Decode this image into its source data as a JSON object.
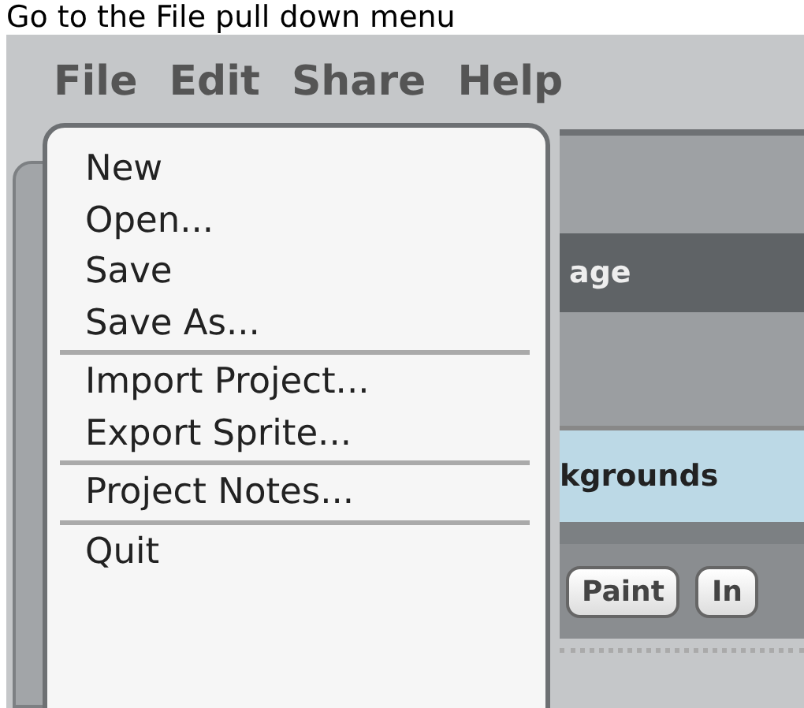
{
  "caption": "Go to the File pull down menu",
  "menubar": [
    "File",
    "Edit",
    "Share",
    "Help"
  ],
  "file_menu": [
    {
      "kind": "item",
      "label": "New"
    },
    {
      "kind": "item",
      "label": "Open..."
    },
    {
      "kind": "item",
      "label": "Save"
    },
    {
      "kind": "item",
      "label": "Save As..."
    },
    {
      "kind": "separator"
    },
    {
      "kind": "item",
      "label": "Import Project..."
    },
    {
      "kind": "item",
      "label": "Export Sprite..."
    },
    {
      "kind": "separator"
    },
    {
      "kind": "item",
      "label": "Project Notes..."
    },
    {
      "kind": "separator"
    },
    {
      "kind": "item",
      "label": "Quit"
    }
  ],
  "stage_tab": "age",
  "backgrounds_tab": "kgrounds",
  "buttons": [
    "Paint",
    "In"
  ]
}
